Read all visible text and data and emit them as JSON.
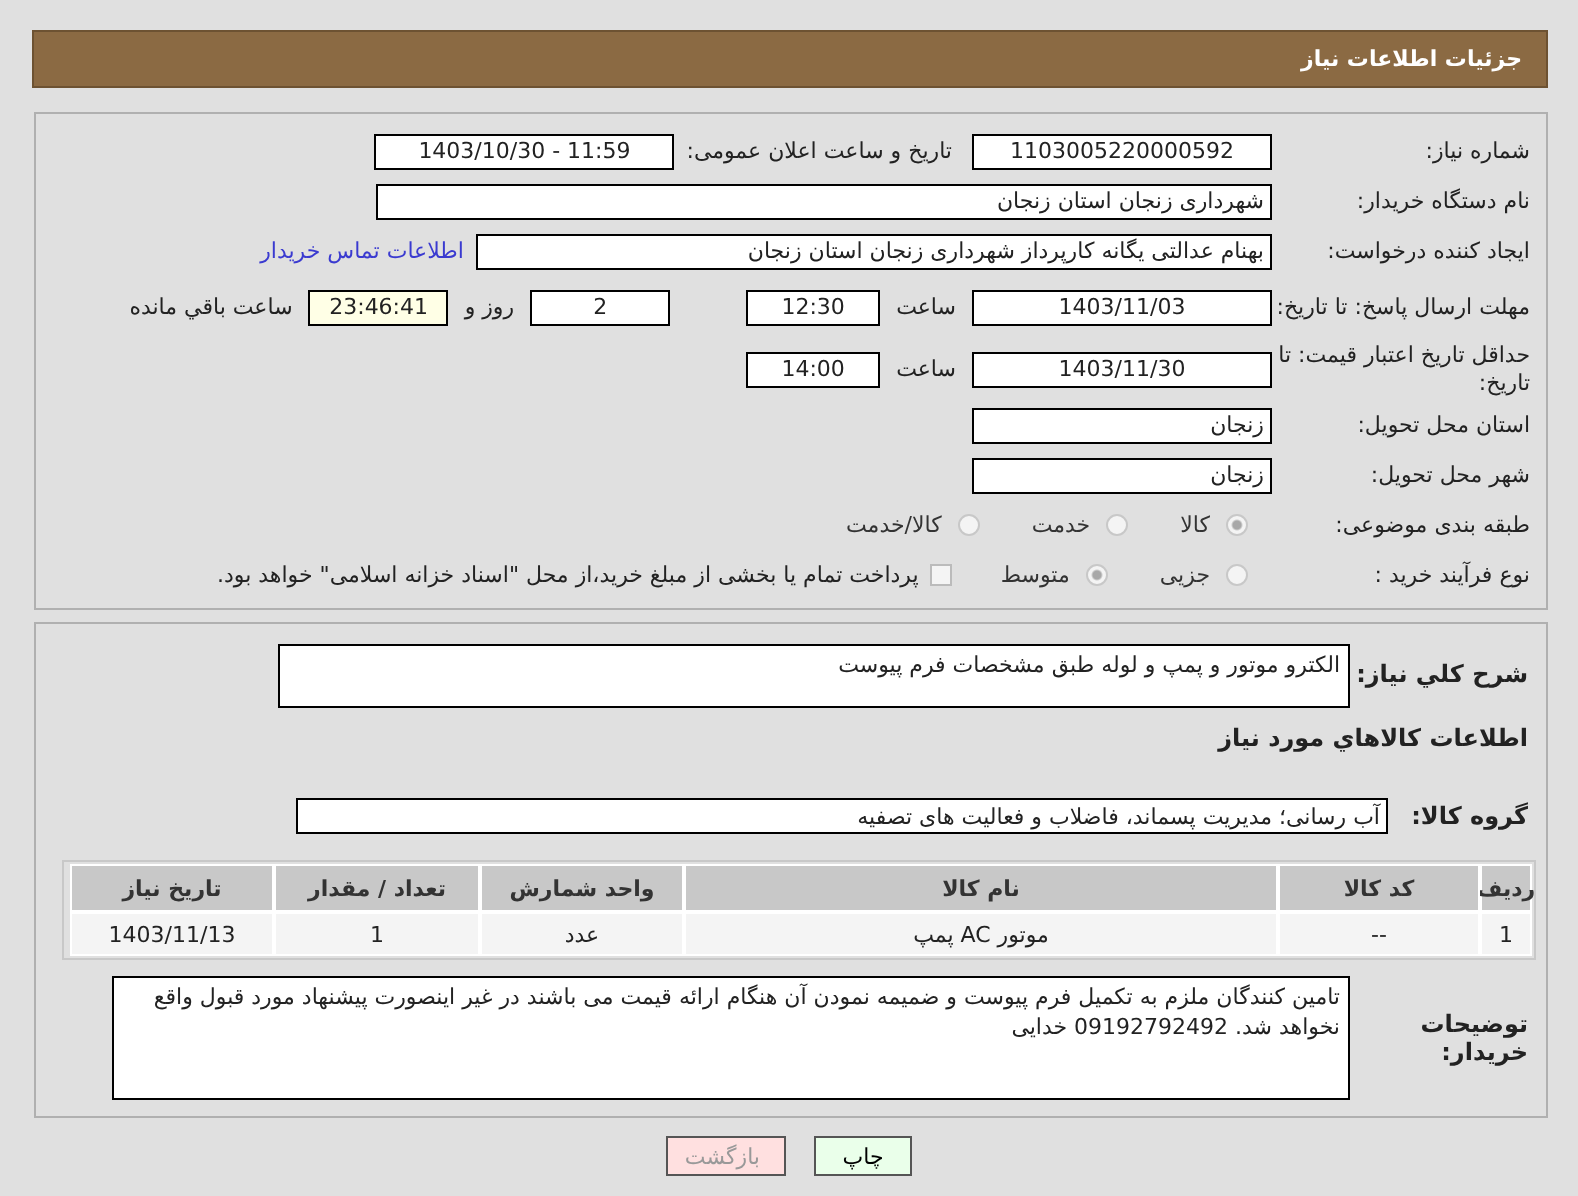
{
  "header": {
    "title": "جزئیات اطلاعات نیاز"
  },
  "need_number": {
    "label": "شماره نیاز:",
    "value": "1103005220000592"
  },
  "announce": {
    "label": "تاریخ و ساعت اعلان عمومی:",
    "value": "1403/10/30 - 11:59"
  },
  "buyer_org": {
    "label": "نام دستگاه خریدار:",
    "value": "شهرداری زنجان استان زنجان"
  },
  "requester": {
    "label": "ایجاد کننده درخواست:",
    "value": "بهنام عدالتی یگانه کارپرداز شهرداری زنجان استان زنجان",
    "link": "اطلاعات تماس خریدار"
  },
  "reply_deadline": {
    "label": "مهلت ارسال پاسخ: تا تاریخ:",
    "date": "1403/11/03",
    "time_label": "ساعت",
    "time": "12:30",
    "days": "2",
    "days_label": "روز و",
    "remaining": "23:46:41",
    "remaining_label": "ساعت باقي مانده"
  },
  "price_validity": {
    "label": "حداقل تاریخ اعتبار قیمت: تا تاریخ:",
    "date": "1403/11/30",
    "time_label": "ساعت",
    "time": "14:00"
  },
  "province": {
    "label": "استان محل تحویل:",
    "value": "زنجان"
  },
  "city": {
    "label": "شهر محل تحویل:",
    "value": "زنجان"
  },
  "category": {
    "label": "طبقه بندی موضوعی:",
    "options": [
      {
        "label": "کالا",
        "selected": true
      },
      {
        "label": "خدمت",
        "selected": false
      },
      {
        "label": "کالا/خدمت",
        "selected": false
      }
    ]
  },
  "purchase_type": {
    "label": "نوع فرآیند خرید :",
    "options": [
      {
        "label": "جزیی",
        "selected": false
      },
      {
        "label": "متوسط",
        "selected": true
      }
    ],
    "payment": {
      "checked": false,
      "text": "پرداخت تمام یا بخشی از مبلغ خرید،از محل \"اسناد خزانه اسلامی\" خواهد بود."
    }
  },
  "summary": {
    "label": "شرح کلي نياز:",
    "value": "الکترو موتور و پمپ و لوله طبق مشخصات فرم پیوست"
  },
  "goods_title": "اطلاعات کالاهاي مورد نياز",
  "goods_group": {
    "label": "گروه کالا:",
    "value": "آب رسانی؛ مدیریت پسماند، فاضلاب و فعالیت های تصفیه"
  },
  "table": {
    "columns": [
      "ردیف",
      "کد کالا",
      "نام کالا",
      "واحد شمارش",
      "تعداد / مقدار",
      "تاریخ نیاز"
    ],
    "rows": [
      [
        "1",
        "--",
        "موتور AC پمپ",
        "عدد",
        "1",
        "1403/11/13"
      ]
    ]
  },
  "buyer_notes": {
    "label": "توضیحات خریدار:",
    "value": "تامین کنندگان ملزم به تکمیل فرم پیوست و ضمیمه نمودن آن هنگام ارائه قیمت می باشند در غیر اینصورت پیشنهاد مورد قبول واقع نخواهد شد. 09192792492 خدایی"
  },
  "buttons": [
    {
      "label": "چاپ",
      "kind": "print"
    },
    {
      "label": "بازگشت",
      "kind": "back"
    }
  ]
}
